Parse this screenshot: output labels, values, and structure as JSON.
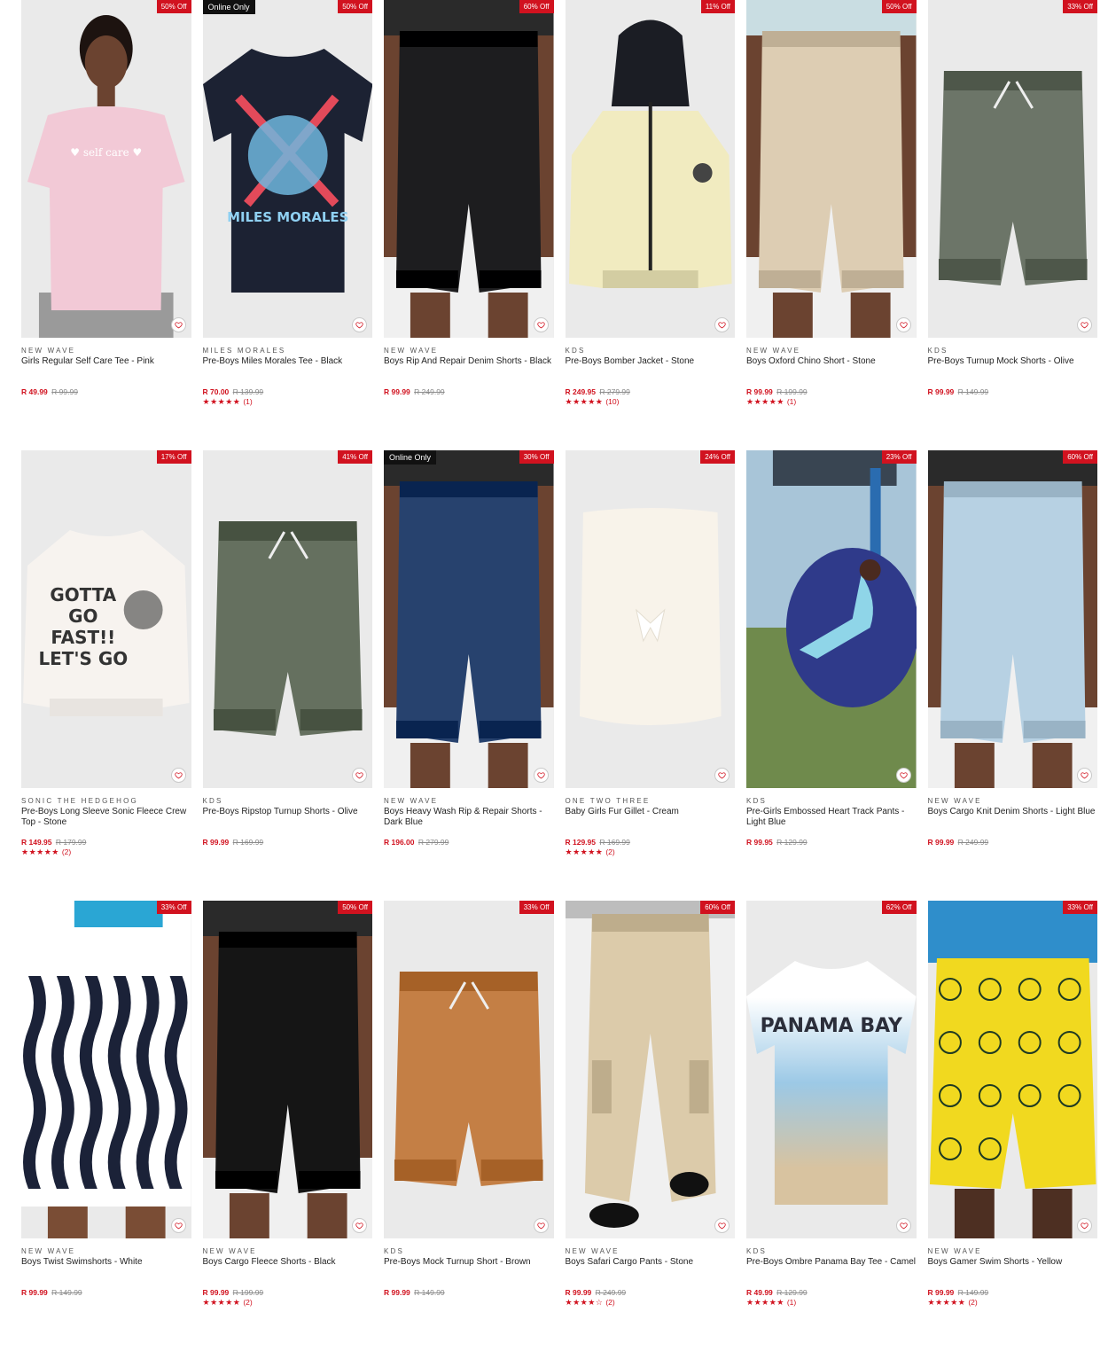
{
  "products": [
    {
      "brand": "NEW WAVE",
      "title": "Girls Regular Self Care Tee - Pink",
      "price": "R 49.99",
      "was": "R 99.99",
      "discount": "50% Off",
      "online": "",
      "stars": "",
      "reviews": "",
      "bg": "#eaeaea",
      "tone": "#f2c9d6",
      "shape": "tee-model",
      "print": "♥ self care ♥"
    },
    {
      "brand": "MILES MORALES",
      "title": "Pre-Boys Miles Morales Tee - Black",
      "price": "R 70.00",
      "was": "R 139.99",
      "discount": "50% Off",
      "online": "Online Only",
      "stars": "★★★★★",
      "reviews": "(1)",
      "bg": "#eaeaea",
      "tone": "#1c2233",
      "shape": "tee",
      "print": "MILES MORALES"
    },
    {
      "brand": "NEW WAVE",
      "title": "Boys Rip And Repair Denim Shorts - Black",
      "price": "R 99.99",
      "was": "R 249.99",
      "discount": "60% Off",
      "online": "",
      "stars": "",
      "reviews": "",
      "bg": "#eaeaea",
      "tone": "#1d1d1f",
      "shape": "shorts-model",
      "print": ""
    },
    {
      "brand": "KDS",
      "title": "Pre-Boys Bomber Jacket - Stone",
      "price": "R 249.95",
      "was": "R 279.99",
      "discount": "11% Off",
      "online": "",
      "stars": "★★★★★",
      "reviews": "(10)",
      "bg": "#eaeaea",
      "tone": "#f1ebc0",
      "shape": "jacket",
      "print": ""
    },
    {
      "brand": "NEW WAVE",
      "title": "Boys Oxford Chino Short - Stone",
      "price": "R 99.99",
      "was": "R 199.99",
      "discount": "50% Off",
      "online": "",
      "stars": "★★★★★",
      "reviews": "(1)",
      "bg": "#eaeaea",
      "tone": "#ddcdb3",
      "shape": "shorts-model",
      "print": ""
    },
    {
      "brand": "KDS",
      "title": "Pre-Boys Turnup Mock Shorts - Olive",
      "price": "R 99.99",
      "was": "R 149.99",
      "discount": "33% Off",
      "online": "",
      "stars": "",
      "reviews": "",
      "bg": "#eaeaea",
      "tone": "#6c7568",
      "shape": "shorts-flat",
      "print": ""
    },
    {
      "brand": "SONIC THE HEDGEHOG",
      "title": "Pre-Boys Long Sleeve Sonic Fleece Crew Top - Stone",
      "price": "R 149.95",
      "was": "R 179.99",
      "discount": "17% Off",
      "online": "",
      "stars": "★★★★★",
      "reviews": "(2)",
      "bg": "#eaeaea",
      "tone": "#f7f3ef",
      "shape": "sweater",
      "print": "GOTTA GO FAST!! LET'S GO"
    },
    {
      "brand": "KDS",
      "title": "Pre-Boys Ripstop Turnup Shorts - Olive",
      "price": "R 99.99",
      "was": "R 169.99",
      "discount": "41% Off",
      "online": "",
      "stars": "",
      "reviews": "",
      "bg": "#eaeaea",
      "tone": "#65705f",
      "shape": "shorts-flat",
      "print": ""
    },
    {
      "brand": "NEW WAVE",
      "title": "Boys Heavy Wash Rip & Repair Shorts - Dark Blue",
      "price": "R 196.00",
      "was": "R 279.99",
      "discount": "30% Off",
      "online": "Online Only",
      "stars": "",
      "reviews": "",
      "bg": "#eaeaea",
      "tone": "#27426e",
      "shape": "shorts-model",
      "print": ""
    },
    {
      "brand": "ONE TWO THREE",
      "title": "Baby Girls Fur Gillet - Cream",
      "price": "R 129.95",
      "was": "R 169.99",
      "discount": "24% Off",
      "online": "",
      "stars": "★★★★★",
      "reviews": "(2)",
      "bg": "#eaeaea",
      "tone": "#f8f3ea",
      "shape": "gilet",
      "print": ""
    },
    {
      "brand": "KDS",
      "title": "Pre-Girls Embossed Heart Track Pants - Light Blue",
      "price": "R 99.95",
      "was": "R 129.99",
      "discount": "23% Off",
      "online": "",
      "stars": "",
      "reviews": "",
      "bg": "#6f8a4c",
      "tone": "#8fd5e8",
      "shape": "photo",
      "print": ""
    },
    {
      "brand": "NEW WAVE",
      "title": "Boys Cargo Knit Denim Shorts - Light Blue",
      "price": "R 99.99",
      "was": "R 249.99",
      "discount": "60% Off",
      "online": "",
      "stars": "",
      "reviews": "",
      "bg": "#eaeaea",
      "tone": "#b7d1e3",
      "shape": "shorts-model",
      "print": ""
    },
    {
      "brand": "NEW WAVE",
      "title": "Boys Twist Swimshorts - White",
      "price": "R 99.99",
      "was": "R 149.99",
      "discount": "33% Off",
      "online": "",
      "stars": "",
      "reviews": "",
      "bg": "#eaeaea",
      "tone": "#1b2238",
      "shape": "swim-wave",
      "print": ""
    },
    {
      "brand": "NEW WAVE",
      "title": "Boys Cargo Fleece Shorts - Black",
      "price": "R 99.99",
      "was": "R 199.99",
      "discount": "50% Off",
      "online": "",
      "stars": "★★★★★",
      "reviews": "(2)",
      "bg": "#eaeaea",
      "tone": "#151515",
      "shape": "shorts-model",
      "print": ""
    },
    {
      "brand": "KDS",
      "title": "Pre-Boys Mock Turnup Short - Brown",
      "price": "R 99.99",
      "was": "R 149.99",
      "discount": "33% Off",
      "online": "",
      "stars": "",
      "reviews": "",
      "bg": "#eaeaea",
      "tone": "#c47f45",
      "shape": "shorts-flat",
      "print": ""
    },
    {
      "brand": "NEW WAVE",
      "title": "Boys Safari Cargo Pants - Stone",
      "price": "R 99.99",
      "was": "R 249.99",
      "discount": "60% Off",
      "online": "",
      "stars": "★★★★☆",
      "reviews": "(2)",
      "bg": "#eaeaea",
      "tone": "#dccbaa",
      "shape": "pants",
      "print": ""
    },
    {
      "brand": "KDS",
      "title": "Pre-Boys Ombre Panama Bay Tee - Camel",
      "price": "R 49.99",
      "was": "R 129.99",
      "discount": "62% Off",
      "online": "",
      "stars": "★★★★★",
      "reviews": "(1)",
      "bg": "#eaeaea",
      "tone": "#a9cde3",
      "shape": "tee-ombre",
      "print": "PANAMA BAY"
    },
    {
      "brand": "NEW WAVE",
      "title": "Boys Gamer Swim Shorts - Yellow",
      "price": "R 99.99",
      "was": "R 149.99",
      "discount": "33% Off",
      "online": "",
      "stars": "★★★★★",
      "reviews": "(2)",
      "bg": "#eaeaea",
      "tone": "#f1d91f",
      "shape": "swim-yellow",
      "print": ""
    }
  ]
}
